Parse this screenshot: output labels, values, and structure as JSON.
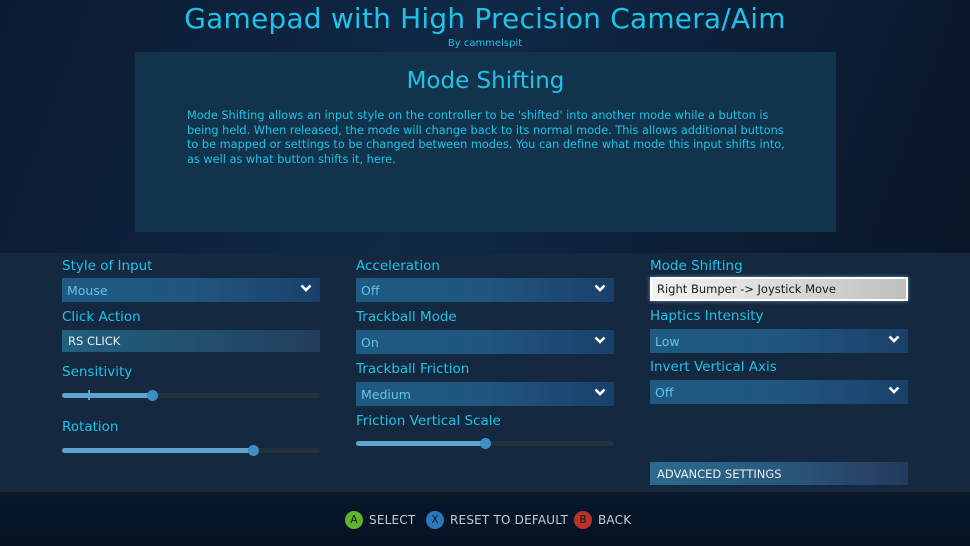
{
  "header": {
    "title": "Gamepad with High Precision Camera/Aim",
    "author": "By cammelspit"
  },
  "info": {
    "title": "Mode Shifting",
    "body": "Mode Shifting allows an input style on the controller to be 'shifted' into another mode while a button is being held.  When released, the mode will change back to its normal mode.  This allows additional buttons to be mapped or settings to be changed between modes.  You can define what mode this input shifts into, as well as what button shifts it, here."
  },
  "settings": {
    "style_of_input": {
      "label": "Style of Input",
      "value": "Mouse"
    },
    "click_action": {
      "label": "Click Action",
      "value": "RS CLICK"
    },
    "sensitivity": {
      "label": "Sensitivity",
      "value": 0.35,
      "default_mark": 0.1
    },
    "rotation": {
      "label": "Rotation",
      "value": 0.74
    },
    "acceleration": {
      "label": "Acceleration",
      "value": "Off"
    },
    "trackball_mode": {
      "label": "Trackball Mode",
      "value": "On"
    },
    "trackball_friction": {
      "label": "Trackball Friction",
      "value": "Medium"
    },
    "friction_vertical_scale": {
      "label": "Friction Vertical Scale",
      "value": 0.5
    },
    "mode_shifting": {
      "label": "Mode Shifting",
      "value": "Right Bumper -> Joystick Move"
    },
    "haptics_intensity": {
      "label": "Haptics Intensity",
      "value": "Low"
    },
    "invert_vertical_axis": {
      "label": "Invert Vertical Axis",
      "value": "Off"
    },
    "advanced_settings": {
      "label": "ADVANCED SETTINGS"
    }
  },
  "footer": {
    "hints": [
      {
        "button": "A",
        "label": "SELECT",
        "color": "#5fb32e"
      },
      {
        "button": "X",
        "label": "RESET TO DEFAULT",
        "color": "#2a79c0"
      },
      {
        "button": "B",
        "label": "BACK",
        "color": "#b8342a"
      }
    ]
  },
  "colors": {
    "accent_text": "#1fc3e8",
    "info_panel_bg": "#12334c",
    "settings_bg": "#14283f"
  }
}
